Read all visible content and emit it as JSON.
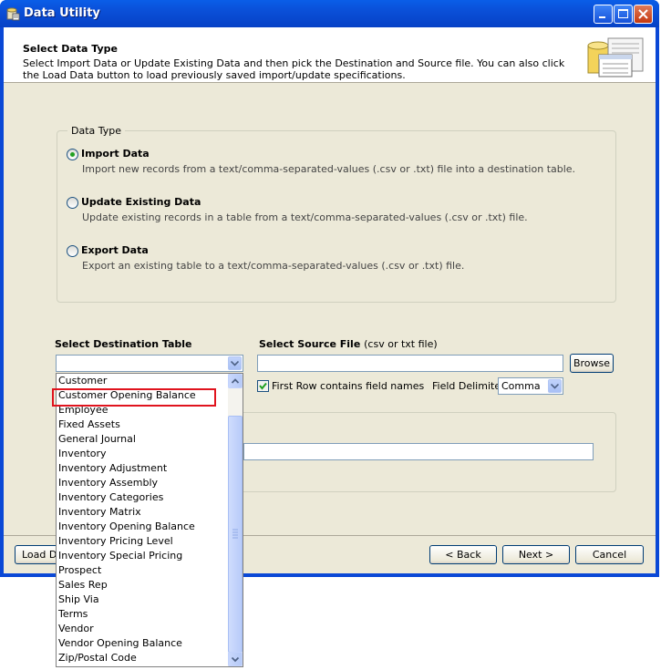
{
  "window": {
    "title": "Data Utility"
  },
  "header": {
    "title": "Select Data Type",
    "description": "Select Import Data or Update Existing Data and then pick the Destination and Source file.  You can also click the Load Data button to load previously saved import/update specifications."
  },
  "data_type": {
    "legend": "Data Type",
    "options": [
      {
        "label": "Import Data",
        "description": "Import new records from a text/comma-separated-values (.csv or .txt) file into a destination table.",
        "checked": true
      },
      {
        "label": "Update Existing Data",
        "description": "Update existing records in a table from a text/comma-separated-values (.csv or .txt) file.",
        "checked": false
      },
      {
        "label": "Export Data",
        "description": "Export an existing table to a text/comma-separated-values (.csv or .txt) file.",
        "checked": false
      }
    ]
  },
  "destination": {
    "label": "Select Destination Table",
    "value": "",
    "options": [
      "Customer",
      "Customer Opening Balance",
      "Employee",
      "Fixed Assets",
      "General Journal",
      "Inventory",
      "Inventory Adjustment",
      "Inventory Assembly",
      "Inventory Categories",
      "Inventory Matrix",
      "Inventory Opening Balance",
      "Inventory Pricing Level",
      "Inventory Special Pricing",
      "Prospect",
      "Sales Rep",
      "Ship Via",
      "Terms",
      "Vendor",
      "Vendor Opening Balance",
      "Zip/Postal Code"
    ],
    "highlighted_option": "Customer Opening Balance"
  },
  "source": {
    "label": "Select Source File",
    "label_hint": "(csv or txt file)",
    "value": "",
    "browse_label": "Browse",
    "first_row_label": "First Row contains field names",
    "first_row_checked": true,
    "delimiter_label": "Field Delimiter",
    "delimiter_value": "Comma"
  },
  "footer": {
    "load_label": "Load Da",
    "back_label": "< Back",
    "next_label": "Next >",
    "cancel_label": "Cancel"
  },
  "colors": {
    "titlebar": "#0a4fd8",
    "highlight": "#e0141e",
    "radio_checked": "#21a121"
  }
}
